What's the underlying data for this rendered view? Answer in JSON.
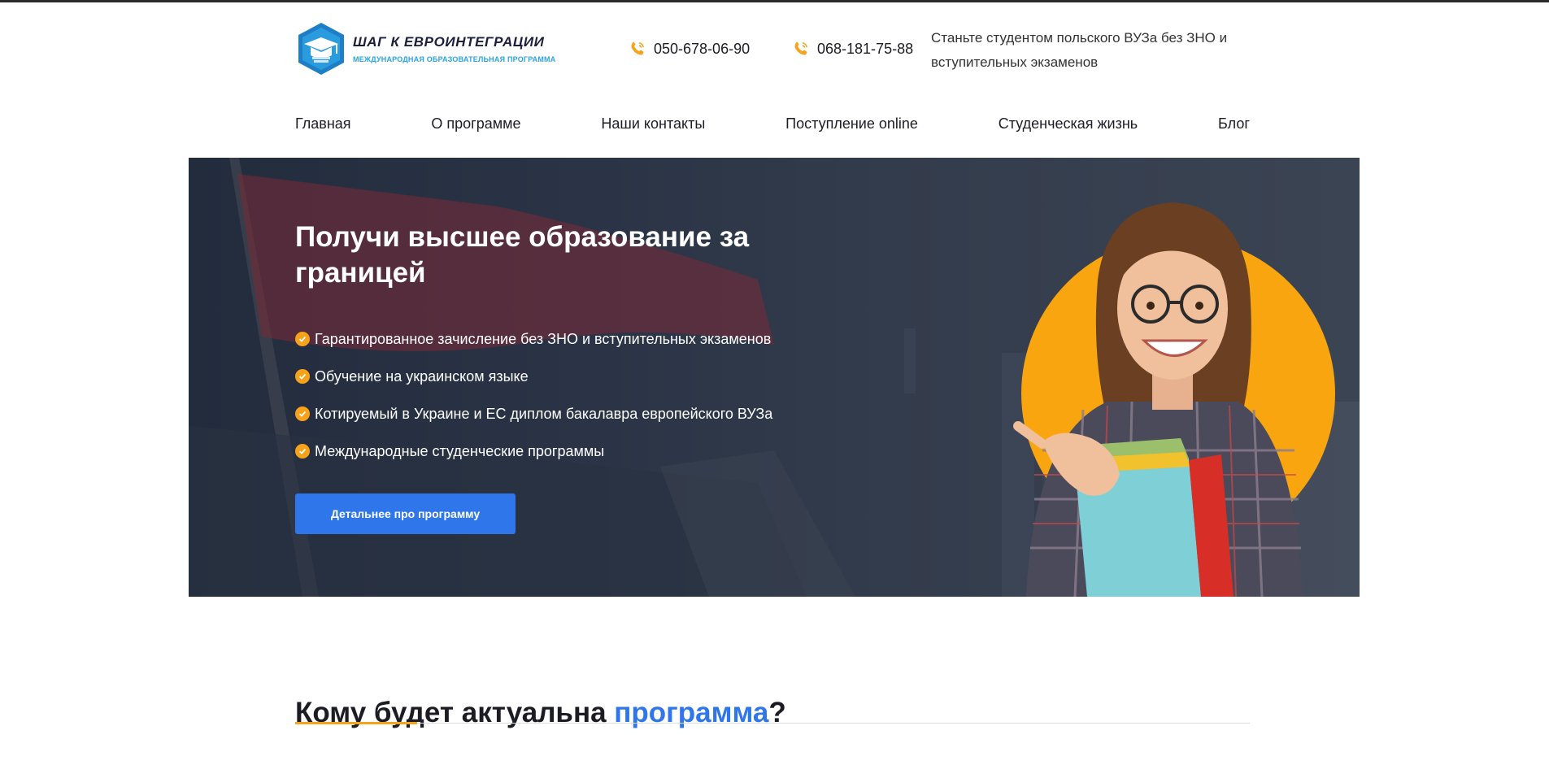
{
  "header": {
    "logo_title": "ШАГ К ЕВРОИНТЕГРАЦИИ",
    "logo_subtitle": "МЕЖДУНАРОДНАЯ ОБРАЗОВАТЕЛЬНАЯ ПРОГРАММА",
    "phones": [
      "050-678-06-90",
      "068-181-75-88"
    ],
    "tagline": "Станьте студентом польского ВУЗа без ЗНО и вступительных экзаменов"
  },
  "nav": {
    "items": [
      "Главная",
      "О программе",
      "Наши контакты",
      "Поступление online",
      "Студенческая жизнь",
      "Блог"
    ]
  },
  "hero": {
    "title": "Получи высшее образование за границей",
    "bullets": [
      "Гарантированное зачисление без ЗНО и вступительных экзаменов",
      "Обучение на украинском языке",
      "Котируемый в Украине и ЕС диплом бакалавра европейского ВУЗа",
      "Международные студенческие программы"
    ],
    "cta_label": "Детальнее про программу"
  },
  "section": {
    "title_main": "Кому будет актуальна ",
    "title_accent": "программа",
    "title_end": "?"
  },
  "colors": {
    "accent_blue": "#2f76ea",
    "accent_orange": "#f7a21b",
    "hero_dark": "#2a3446"
  },
  "icons": {
    "phone": "phone-icon",
    "check": "check-circle-icon",
    "logo": "graduation-cap-hexagon-icon"
  }
}
